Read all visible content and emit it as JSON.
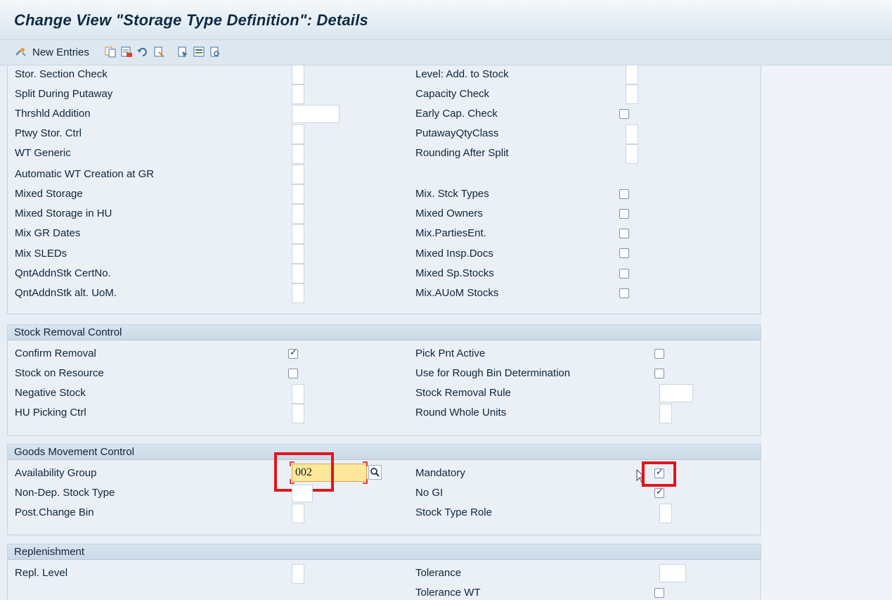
{
  "title": "Change View \"Storage Type Definition\": Details",
  "toolbar": {
    "new_entries_label": "New Entries",
    "icons": [
      "edit-glasses-icon",
      "copy-icon",
      "delete-icon",
      "undo-icon",
      "select-all-icon",
      "select-block-icon",
      "deselect-all-icon",
      "print-icon"
    ]
  },
  "putaway": {
    "left": [
      {
        "label": "Stor. Section Check"
      },
      {
        "label": "Split During Putaway"
      },
      {
        "label": "Thrshld Addition"
      },
      {
        "label": "Ptwy Stor. Ctrl"
      },
      {
        "label": "WT Generic"
      },
      {
        "label": "Automatic WT Creation at GR"
      },
      {
        "label": "Mixed Storage"
      },
      {
        "label": "Mixed Storage in HU"
      },
      {
        "label": "Mix GR Dates"
      },
      {
        "label": "Mix SLEDs"
      },
      {
        "label": "QntAddnStk CertNo."
      },
      {
        "label": "QntAddnStk alt. UoM."
      }
    ],
    "right": [
      {
        "label": "Level: Add. to Stock"
      },
      {
        "label": "Capacity Check"
      },
      {
        "label": "Early Cap. Check"
      },
      {
        "label": "PutawayQtyClass"
      },
      {
        "label": "Rounding After Split"
      },
      {
        "label": "Mix. Stck Types"
      },
      {
        "label": "Mixed Owners"
      },
      {
        "label": "Mix.PartiesEnt."
      },
      {
        "label": "Mixed Insp.Docs"
      },
      {
        "label": "Mixed Sp.Stocks"
      },
      {
        "label": "Mix.AUoM Stocks"
      }
    ]
  },
  "stock_removal": {
    "header": "Stock Removal Control",
    "left": [
      {
        "label": "Confirm Removal",
        "checked": true
      },
      {
        "label": "Stock on Resource",
        "checked": false
      },
      {
        "label": "Negative Stock"
      },
      {
        "label": "HU Picking Ctrl"
      }
    ],
    "right": [
      {
        "label": "Pick Pnt Active",
        "checked": false
      },
      {
        "label": "Use for Rough Bin Determination",
        "checked": false
      },
      {
        "label": "Stock Removal Rule"
      },
      {
        "label": "Round Whole Units"
      }
    ]
  },
  "goods_movement": {
    "header": "Goods Movement Control",
    "left": [
      {
        "label": "Availability Group",
        "value": "002"
      },
      {
        "label": "Non-Dep. Stock Type"
      },
      {
        "label": "Post.Change Bin"
      }
    ],
    "right": [
      {
        "label": "Mandatory",
        "checked": true
      },
      {
        "label": "No GI",
        "checked": true
      },
      {
        "label": "Stock Type Role"
      }
    ]
  },
  "replenishment": {
    "header": "Replenishment",
    "left": [
      {
        "label": "Repl. Level"
      }
    ],
    "right": [
      {
        "label": "Tolerance"
      },
      {
        "label": "Tolerance WT",
        "checked": false
      }
    ]
  },
  "colors": {
    "highlight_red": "#e0161c",
    "focused_input": "#fde89c",
    "group_header": "#cbd9e7"
  }
}
